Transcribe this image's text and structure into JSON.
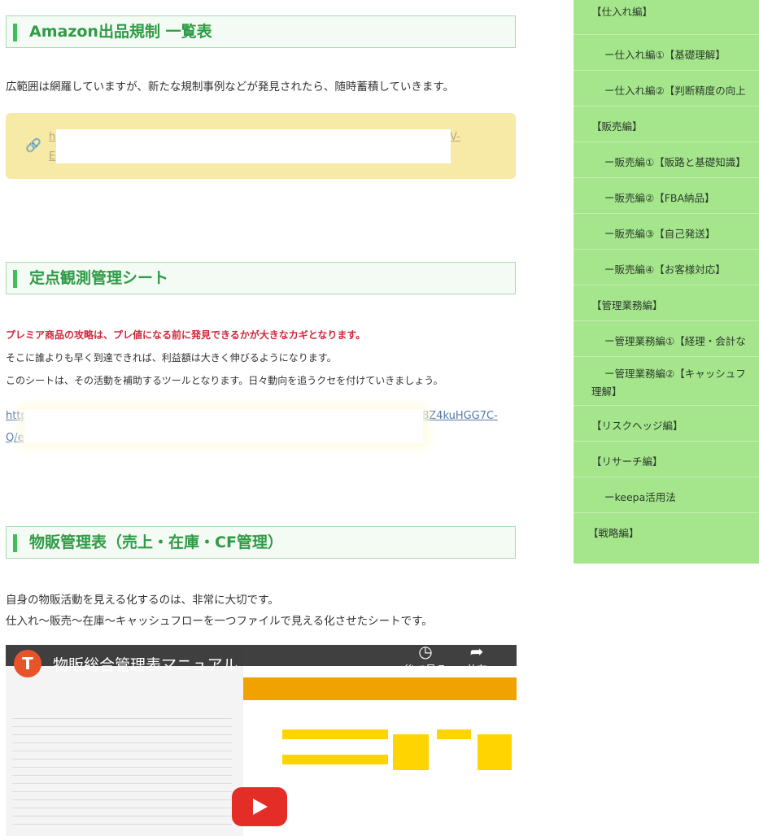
{
  "main": {
    "sections": [
      {
        "title": "Amazon出品規制 一覧表",
        "desc": "広範囲は網羅していますが、新たな規制事例などが発見されたら、随時蓄積していきます。",
        "link_fragments": [
          "h",
          "V-",
          "E"
        ]
      },
      {
        "title": "定点観測管理シート",
        "lead": "プレミア商品の攻略は、プレ値になる前に発見できるかが大きなカギとなります。",
        "lines": [
          "そこに誰よりも早く到達できれば、利益額は大きく伸びるようになります。",
          "このシートは、その活動を補助するツールとなります。日々動向を追うクセを付けていきましょう。"
        ],
        "url_left": "http",
        "url_right": "8Z4kuHGG7C-",
        "url_line2": "Q/e"
      },
      {
        "title": "物販管理表（売上・在庫・CF管理）",
        "lines": [
          "自身の物販活動を見える化するのは、非常に大切です。",
          "仕入れ〜販売〜在庫〜キャッシュフローを一つファイルで見える化させたシートです。"
        ]
      }
    ],
    "video": {
      "title": "物販総合管理表マニュアル",
      "watch_later": "後で見る",
      "share": "共有",
      "channel_initial": "T"
    }
  },
  "sidebar": {
    "items": [
      {
        "label": "【仕入れ編】",
        "indent": 0
      },
      {
        "label": "ー仕入れ編①【基礎理解】",
        "indent": 1
      },
      {
        "label": "ー仕入れ編②【判断精度の向上",
        "indent": 1
      },
      {
        "label": "【販売編】",
        "indent": 0
      },
      {
        "label": "ー販売編①【販路と基礎知識】",
        "indent": 1
      },
      {
        "label": "ー販売編②【FBA納品】",
        "indent": 1
      },
      {
        "label": "ー販売編③【自己発送】",
        "indent": 1
      },
      {
        "label": "ー販売編④【お客様対応】",
        "indent": 1
      },
      {
        "label": "【管理業務編】",
        "indent": 0
      },
      {
        "label": "ー管理業務編①【経理・会計な",
        "indent": 1
      },
      {
        "label": "ー管理業務編②【キャッシュフ",
        "label2": "理解】",
        "indent": 1
      },
      {
        "label": "【リスクヘッジ編】",
        "indent": 0
      },
      {
        "label": "【リサーチ編】",
        "indent": 0
      },
      {
        "label": "ーkeepa活用法",
        "indent": 1
      },
      {
        "label": "【戦略編】",
        "indent": 0
      }
    ]
  },
  "colors": {
    "accent_green": "#2f9b46",
    "sidebar_bg": "#a5e68c",
    "lead_red": "#d0283c",
    "link_card": "#f7e9a6"
  }
}
